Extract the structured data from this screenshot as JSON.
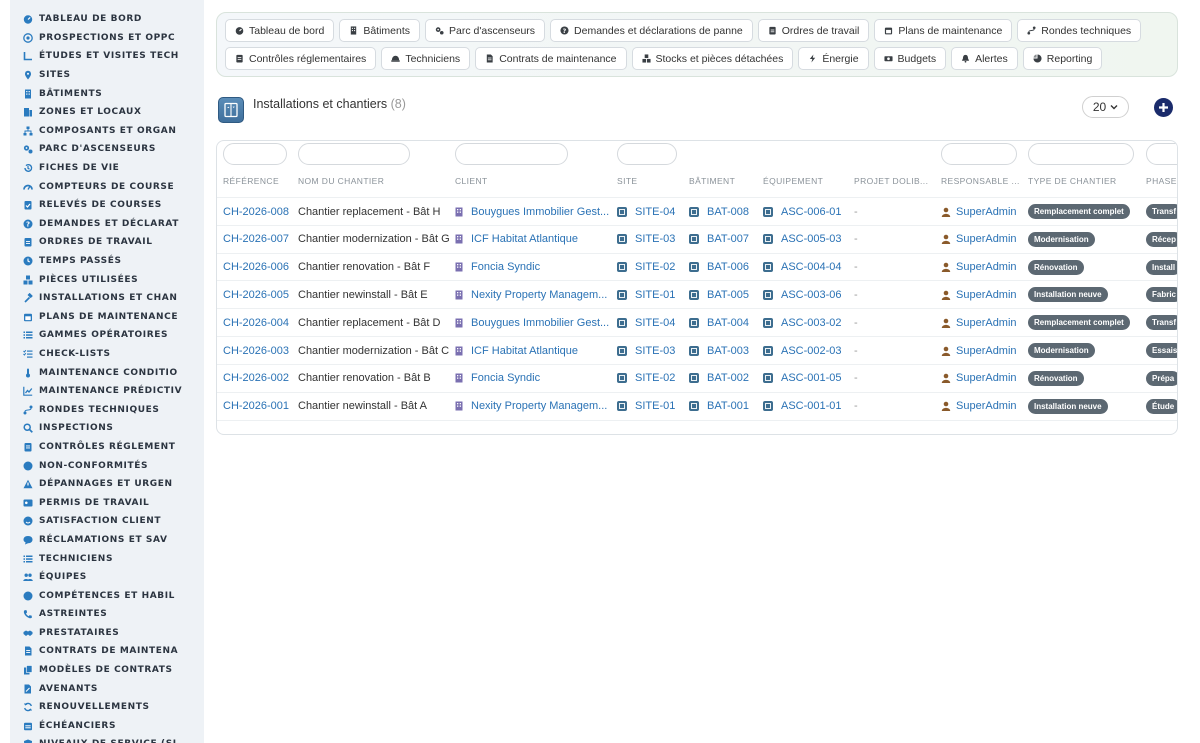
{
  "sidebar": {
    "items": [
      {
        "label": "TABLEAU DE BORD",
        "icon": "dashboard-icon"
      },
      {
        "label": "PROSPECTIONS ET OPPC",
        "icon": "target-icon"
      },
      {
        "label": "ÉTUDES ET VISITES TECH",
        "icon": "ruler-icon"
      },
      {
        "label": "SITES",
        "icon": "location-pin-icon"
      },
      {
        "label": "BÂTIMENTS",
        "icon": "building-icon"
      },
      {
        "label": "ZONES ET LOCAUX",
        "icon": "door-icon"
      },
      {
        "label": "COMPOSANTS ET ORGAN",
        "icon": "sitemap-icon"
      },
      {
        "label": "PARC D'ASCENSEURS",
        "icon": "gears-icon"
      },
      {
        "label": "FICHES DE VIE",
        "icon": "history-icon"
      },
      {
        "label": "COMPTEURS DE COURSE",
        "icon": "gauge-icon"
      },
      {
        "label": "RELEVÉS DE COURSES",
        "icon": "clipboard-check-icon"
      },
      {
        "label": "DEMANDES ET DÉCLARAT",
        "icon": "question-circle-icon"
      },
      {
        "label": "ORDRES DE TRAVAIL",
        "icon": "clipboard-icon"
      },
      {
        "label": "TEMPS PASSÉS",
        "icon": "clock-icon"
      },
      {
        "label": "PIÈCES UTILISÉES",
        "icon": "cubes-icon"
      },
      {
        "label": "INSTALLATIONS ET CHAN",
        "icon": "hammer-icon"
      },
      {
        "label": "PLANS DE MAINTENANCE",
        "icon": "calendar-icon"
      },
      {
        "label": "GAMMES OPÉRATOIRES",
        "icon": "list-icon"
      },
      {
        "label": "CHECK-LISTS",
        "icon": "checklist-icon"
      },
      {
        "label": "MAINTENANCE CONDITIO",
        "icon": "thermometer-icon"
      },
      {
        "label": "MAINTENANCE PRÉDICTIV",
        "icon": "chart-line-icon"
      },
      {
        "label": "RONDES TECHNIQUES",
        "icon": "route-icon"
      },
      {
        "label": "INSPECTIONS",
        "icon": "magnifier-icon"
      },
      {
        "label": "CONTRÔLES RÉGLEMENT",
        "icon": "list-check-icon"
      },
      {
        "label": "NON-CONFORMITÉS",
        "icon": "alert-circle-icon"
      },
      {
        "label": "DÉPANNAGES ET URGEN",
        "icon": "warning-triangle-icon"
      },
      {
        "label": "PERMIS DE TRAVAIL",
        "icon": "id-card-icon"
      },
      {
        "label": "SATISFACTION CLIENT",
        "icon": "smile-icon"
      },
      {
        "label": "RÉCLAMATIONS ET SAV",
        "icon": "comment-icon"
      },
      {
        "label": "TECHNICIENS",
        "icon": "list-icon"
      },
      {
        "label": "ÉQUIPES",
        "icon": "users-icon"
      },
      {
        "label": "COMPÉTENCES ET HABIL",
        "icon": "badge-icon"
      },
      {
        "label": "ASTREINTES",
        "icon": "phone-icon"
      },
      {
        "label": "PRESTATAIRES",
        "icon": "handshake-icon"
      },
      {
        "label": "CONTRATS DE MAINTENA",
        "icon": "contract-icon"
      },
      {
        "label": "MODÈLES DE CONTRATS",
        "icon": "file-copy-icon"
      },
      {
        "label": "AVENANTS",
        "icon": "file-pen-icon"
      },
      {
        "label": "RENOUVELLEMENTS",
        "icon": "refresh-icon"
      },
      {
        "label": "ÉCHÉANCIERS",
        "icon": "calendar-lines-icon"
      },
      {
        "label": "NIVEAUX DE SERVICE (SL",
        "icon": "shield-icon"
      }
    ]
  },
  "topnav": {
    "row1": [
      {
        "label": "Tableau de bord",
        "icon": "dashboard-icon"
      },
      {
        "label": "Bâtiments",
        "icon": "building-icon"
      },
      {
        "label": "Parc d'ascenseurs",
        "icon": "gears-icon"
      },
      {
        "label": "Demandes et déclarations de panne",
        "icon": "question-circle-icon"
      },
      {
        "label": "Ordres de travail",
        "icon": "clipboard-icon"
      },
      {
        "label": "Plans de maintenance",
        "icon": "calendar-icon"
      },
      {
        "label": "Rondes techniques",
        "icon": "route-icon"
      }
    ],
    "row2": [
      {
        "label": "Contrôles réglementaires",
        "icon": "list-check-icon"
      },
      {
        "label": "Techniciens",
        "icon": "hardhat-icon"
      },
      {
        "label": "Contrats de maintenance",
        "icon": "contract-icon"
      },
      {
        "label": "Stocks et pièces détachées",
        "icon": "cubes-icon"
      },
      {
        "label": "Énergie",
        "icon": "bolt-icon"
      },
      {
        "label": "Budgets",
        "icon": "money-icon"
      },
      {
        "label": "Alertes",
        "icon": "bell-icon"
      },
      {
        "label": "Reporting",
        "icon": "pie-chart-icon"
      }
    ]
  },
  "page": {
    "title": "Installations et chantiers",
    "count": "(8)",
    "per_page": "20"
  },
  "table": {
    "headers": {
      "ref": "RÉFÉRENCE",
      "name": "NOM DU CHANTIER",
      "client": "CLIENT",
      "site": "SITE",
      "building": "BÂTIMENT",
      "equipment": "ÉQUIPEMENT",
      "project": "PROJET DOLIB...",
      "manager": "RESPONSABLE ...",
      "type": "TYPE DE CHANTIER",
      "phase": "PHASE"
    },
    "rows": [
      {
        "ref": "CH-2026-008",
        "name": "Chantier replacement - Bât H",
        "client": "Bouygues Immobilier Gest...",
        "site": "SITE-04",
        "building": "BAT-008",
        "equipment": "ASC-006-01",
        "project": "-",
        "manager": "SuperAdmin",
        "type": "Remplacement complet",
        "phase": "Transf"
      },
      {
        "ref": "CH-2026-007",
        "name": "Chantier modernization - Bât G",
        "client": "ICF Habitat Atlantique",
        "site": "SITE-03",
        "building": "BAT-007",
        "equipment": "ASC-005-03",
        "project": "-",
        "manager": "SuperAdmin",
        "type": "Modernisation",
        "phase": "Récep"
      },
      {
        "ref": "CH-2026-006",
        "name": "Chantier renovation - Bât F",
        "client": "Foncia Syndic",
        "site": "SITE-02",
        "building": "BAT-006",
        "equipment": "ASC-004-04",
        "project": "-",
        "manager": "SuperAdmin",
        "type": "Rénovation",
        "phase": "Install"
      },
      {
        "ref": "CH-2026-005",
        "name": "Chantier newinstall - Bât E",
        "client": "Nexity Property Managem...",
        "site": "SITE-01",
        "building": "BAT-005",
        "equipment": "ASC-003-06",
        "project": "-",
        "manager": "SuperAdmin",
        "type": "Installation neuve",
        "phase": "Fabric"
      },
      {
        "ref": "CH-2026-004",
        "name": "Chantier replacement - Bât D",
        "client": "Bouygues Immobilier Gest...",
        "site": "SITE-04",
        "building": "BAT-004",
        "equipment": "ASC-003-02",
        "project": "-",
        "manager": "SuperAdmin",
        "type": "Remplacement complet",
        "phase": "Transf"
      },
      {
        "ref": "CH-2026-003",
        "name": "Chantier modernization - Bât C",
        "client": "ICF Habitat Atlantique",
        "site": "SITE-03",
        "building": "BAT-003",
        "equipment": "ASC-002-03",
        "project": "-",
        "manager": "SuperAdmin",
        "type": "Modernisation",
        "phase": "Essais"
      },
      {
        "ref": "CH-2026-002",
        "name": "Chantier renovation - Bât B",
        "client": "Foncia Syndic",
        "site": "SITE-02",
        "building": "BAT-002",
        "equipment": "ASC-001-05",
        "project": "-",
        "manager": "SuperAdmin",
        "type": "Rénovation",
        "phase": "Prépa"
      },
      {
        "ref": "CH-2026-001",
        "name": "Chantier newinstall - Bât A",
        "client": "Nexity Property Managem...",
        "site": "SITE-01",
        "building": "BAT-001",
        "equipment": "ASC-001-01",
        "project": "-",
        "manager": "SuperAdmin",
        "type": "Installation neuve",
        "phase": "Étude"
      }
    ]
  },
  "colors": {
    "accent": "#2a72b5",
    "sidebar_bg": "#eef2f6",
    "badge_bg": "#5c6872",
    "add_button": "#1a2b6b"
  }
}
